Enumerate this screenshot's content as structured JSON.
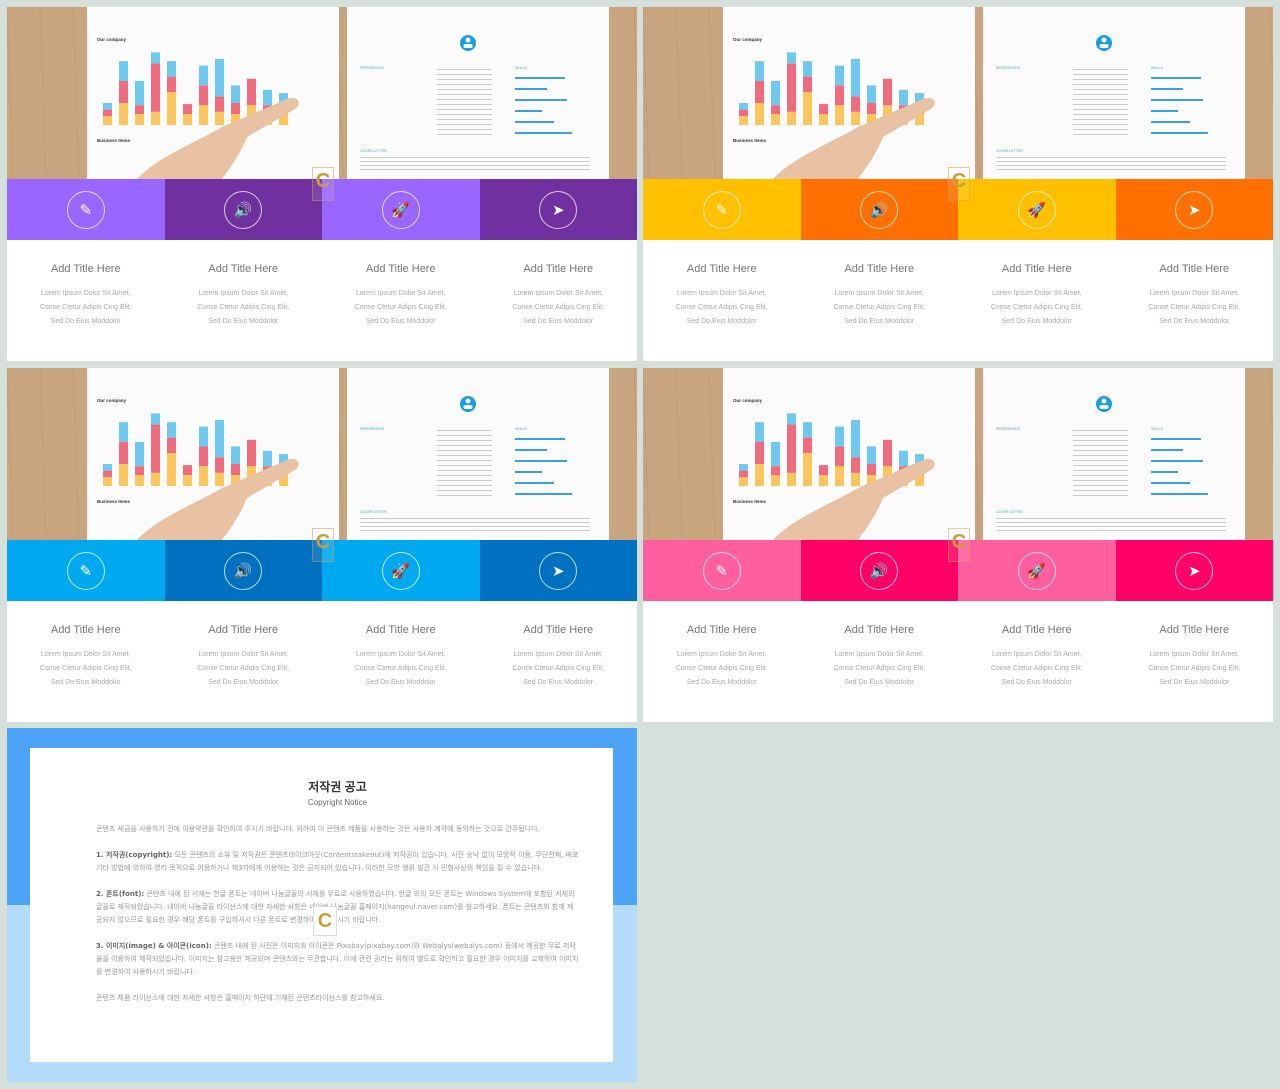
{
  "columns": [
    {
      "title": "Add Title Here",
      "desc": "Lorem Ipsum Dolor Sit Amet,\nConse Ctetur Adipis Cing Elit,\nSed Do Eius  Moddolor",
      "icon": "edit-note-icon",
      "glyph": "✎"
    },
    {
      "title": "Add Title Here",
      "desc": "Lorem Ipsum Dolor Sit Amet,\nConse Ctetur Adipis Cing Elit,\nSed Do Eius  Moddolor",
      "icon": "speaker-icon",
      "glyph": "🔊"
    },
    {
      "title": "Add Title Here",
      "desc": "Lorem Ipsum Dolor Sit Amet,\nConse Ctetur Adipis Cing Elit,\nSed Do Eius  Moddolor",
      "icon": "rocket-icon",
      "glyph": "🚀"
    },
    {
      "title": "Add Title Here",
      "desc": "Lorem Ipsum Dolor Sit Amet,\nConse Ctetur Adipis Cing Elit,\nSed Do Eius  Moddolor",
      "icon": "paper-plane-icon",
      "glyph": "➤"
    }
  ],
  "photo": {
    "chart_title": "Our company",
    "section_title": "Business Items",
    "references": "REFERENCES",
    "skills": "SKILLS",
    "cover_letter": "COVER LETTER"
  },
  "themes": [
    {
      "name": "purple",
      "light": "#9966ff",
      "dark": "#7030a0"
    },
    {
      "name": "yellow-orange",
      "light": "#ffc000",
      "dark": "#ff7000"
    },
    {
      "name": "blue",
      "light": "#00a8f0",
      "dark": "#0070c0"
    },
    {
      "name": "pink",
      "light": "#ff5f9e",
      "dark": "#ff0066"
    }
  ],
  "watermark": "C",
  "copyright": {
    "title": "저작권 공고",
    "subtitle": "Copyright Notice",
    "intro": "콘텐츠 세금을 사용하기 전에 이용약관을 확인하여 주시기 바랍니다. 위하여 이 콘텐츠 제품을 사용하는 것은 사용자 계약에 동의하는 것으로 간주됩니다.",
    "s1_head": "1. 저작권(copyright):",
    "s1": " 모든 콘텐츠의 소유 및 저작권은 콘텐츠테이크아웃(Contentstakeout)에 저작권이 있습니다. 사전 승낙 없이 모방적 이용, 무단전재, 배포 기타 방법에 의하여 영리 목적으로 이용하거나 제3자에게 이용하는 것은 금지되어 있습니다. 이러한 모방 행위 발견 시 민형사상의 책임을 질 수 있습니다.",
    "s2_head": "2. 폰트(font):",
    "s2": " 콘텐츠 내에 된 서체는 한글 폰트는 네이버 나눔글꼴의 서체를 무료로 사용하였습니다. 한글 외의 모든 폰트는 Windows System에 포함된 서체의 글꼴로 제작되었습니다. 네이버 나눔글꼴 라이선스에 대한 자세한 사항은 네이버 나눔글꼴 홈페이지(hangeul.naver.com)를 참고하세요. 폰트는 콘텐츠와 함께 제공되지 않으므로 필요한 경우 해당 폰트를 구입하셔서 다른 폰트로 변경하여 사용하시기 바랍니다.",
    "s3_head": "3. 이미지(image) & 아이콘(icon):",
    "s3": " 콘텐츠 내에 된 사진은 이미지와 아이콘은 Pixabay(pixabay.com)와 Webalys(webalys.com) 등에서 제공한 무료 저작물을 이용하여 제작되었습니다. 이미지는 참고용만 제공되며 콘텐츠와는 무관합니다. 이에 관련 권리는 위하여 별도로 확인하고 필요한 경우 이미지를 교체하여 이미지를 변경하여 사용하시기 바랍니다.",
    "outro": "콘텐츠 제품 라이선스에 대한 자세한 사항은 홈페이지 하단에 기재된 콘텐츠라이선스를 참고하세요."
  }
}
